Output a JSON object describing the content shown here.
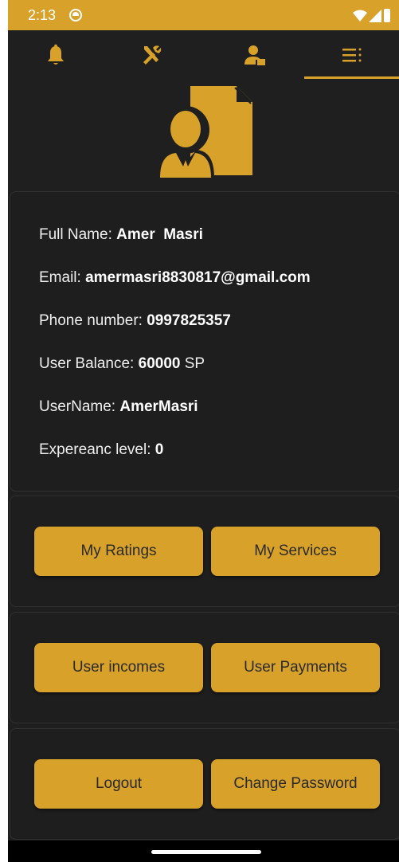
{
  "status_bar": {
    "time": "2:13",
    "background": "#d8a12a"
  },
  "tabs": [
    {
      "name": "notifications",
      "icon": "bell-icon",
      "active": false
    },
    {
      "name": "services",
      "icon": "tools-icon",
      "active": false
    },
    {
      "name": "profile",
      "icon": "user-document-icon",
      "active": false
    },
    {
      "name": "menu",
      "icon": "menu-icon",
      "active": true
    }
  ],
  "profile": {
    "icon": "user-document-icon",
    "full_name_label": "Full Name: ",
    "full_name": "Amer  Masri",
    "email_label": "Email: ",
    "email": "amermasri8830817@gmail.com",
    "phone_label": "Phone number: ",
    "phone": "0997825357",
    "balance_label": "User Balance: ",
    "balance": "60000",
    "balance_unit": " SP",
    "username_label": "UserName: ",
    "username": "AmerMasri",
    "experience_label": "Expereanc level: ",
    "experience": "0"
  },
  "actions": {
    "my_ratings": "My Ratings",
    "my_services": "My Services",
    "user_incomes": "User incomes",
    "user_payments": "User Payments",
    "logout": "Logout",
    "change_password": "Change Password"
  },
  "colors": {
    "accent": "#d8a12a",
    "background": "#1f1f1f",
    "text": "#ffffff"
  }
}
